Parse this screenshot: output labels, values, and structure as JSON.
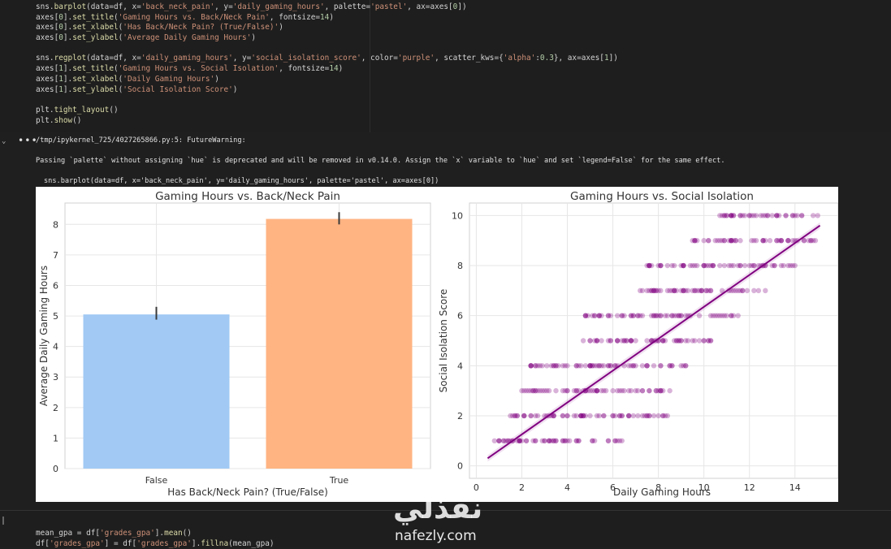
{
  "code_cell": {
    "lines": [
      "sns.barplot(data=df, x='back_neck_pain', y='daily_gaming_hours', palette='pastel', ax=axes[0])",
      "axes[0].set_title('Gaming Hours vs. Back/Neck Pain', fontsize=14)",
      "axes[0].set_xlabel('Has Back/Neck Pain? (True/False)')",
      "axes[0].set_ylabel('Average Daily Gaming Hours')",
      "",
      "sns.regplot(data=df, x='daily_gaming_hours', y='social_isolation_score', color='purple', scatter_kws={'alpha':0.3}, ax=axes[1])",
      "axes[1].set_title('Gaming Hours vs. Social Isolation', fontsize=14)",
      "axes[1].set_xlabel('Daily Gaming Hours')",
      "axes[1].set_ylabel('Social Isolation Score')",
      "",
      "plt.tight_layout()",
      "plt.show()"
    ]
  },
  "output": {
    "dots": "•••",
    "warning_header": "/tmp/ipykernel_725/4027265866.py:5: FutureWarning:",
    "warning_body": "Passing `palette` without assigning `hue` is deprecated and will be removed in v0.14.0. Assign the `x` variable to `hue` and set `legend=False` for the same effect.",
    "warning_code": "sns.barplot(data=df, x='back_neck_pain', y='daily_gaming_hours', palette='pastel', ax=axes[0])"
  },
  "bottom_cell": {
    "lines": [
      "mean_gpa = df['grades_gpa'].mean()",
      "df['grades_gpa'] = df['grades_gpa'].fillna(mean_gpa)"
    ]
  },
  "watermark": {
    "arabic": "نفذلي",
    "url": "nafezly.com"
  },
  "chart_data": [
    {
      "type": "bar",
      "title": "Gaming Hours vs. Back/Neck Pain",
      "xlabel": "Has Back/Neck Pain? (True/False)",
      "ylabel": "Average Daily Gaming Hours",
      "categories": [
        "False",
        "True"
      ],
      "values": [
        5.05,
        8.18
      ],
      "error_low": [
        4.88,
        8.0
      ],
      "error_high": [
        5.3,
        8.4
      ],
      "colors": [
        "#a1c9f4",
        "#ffb482"
      ],
      "ylim": [
        0,
        8.7
      ],
      "yticks": [
        0,
        1,
        2,
        3,
        4,
        5,
        6,
        7,
        8
      ],
      "grid": true
    },
    {
      "type": "scatter",
      "title": "Gaming Hours vs. Social Isolation",
      "xlabel": "Daily Gaming Hours",
      "ylabel": "Social Isolation Score",
      "xlim": [
        -0.3,
        15.9
      ],
      "ylim": [
        -0.5,
        10.5
      ],
      "xticks": [
        0,
        2,
        4,
        6,
        8,
        10,
        12,
        14
      ],
      "yticks": [
        0,
        2,
        4,
        6,
        8,
        10
      ],
      "color": "#800080",
      "regression": {
        "x": [
          0.5,
          15.1
        ],
        "y": [
          0.3,
          9.6
        ]
      },
      "rows": [
        {
          "y": 1,
          "x_min": 0.5,
          "x_max": 6.5
        },
        {
          "y": 2,
          "x_min": 1.5,
          "x_max": 8.5
        },
        {
          "y": 3,
          "x_min": 2.0,
          "x_max": 8.7
        },
        {
          "y": 4,
          "x_min": 2.2,
          "x_max": 9.3
        },
        {
          "y": 5,
          "x_min": 4.5,
          "x_max": 10.5
        },
        {
          "y": 6,
          "x_min": 4.8,
          "x_max": 11.5
        },
        {
          "y": 7,
          "x_min": 7.2,
          "x_max": 13.0
        },
        {
          "y": 8,
          "x_min": 7.5,
          "x_max": 14.0
        },
        {
          "y": 9,
          "x_min": 9.5,
          "x_max": 15.0
        },
        {
          "y": 10,
          "x_min": 10.5,
          "x_max": 15.0
        }
      ],
      "grid": true
    }
  ]
}
